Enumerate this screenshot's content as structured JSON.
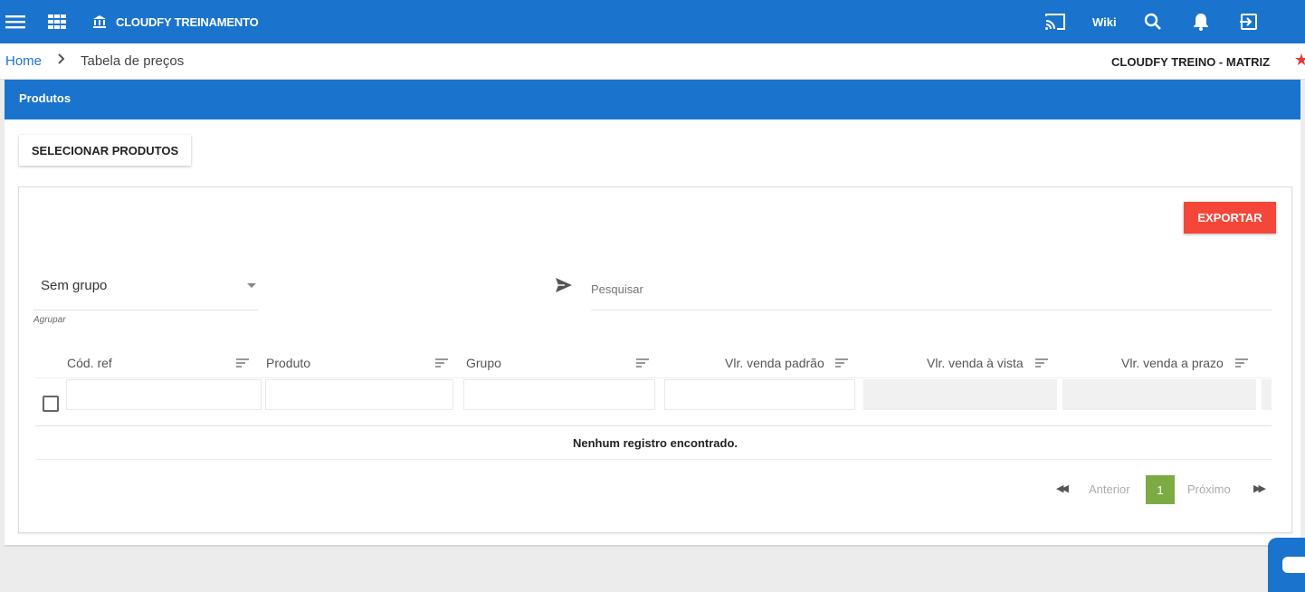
{
  "topbar": {
    "app_title": "CLOUDFY TREINAMENTO",
    "wiki_label": "Wiki",
    "icons": [
      "menu-icon",
      "grid-icon",
      "bank-icon",
      "cast-icon",
      "search-icon",
      "bell-icon",
      "logout-icon",
      "more-vert-icon"
    ],
    "color": "#1a73cc"
  },
  "breadcrumb": {
    "home": "Home",
    "separator": ">",
    "current": "Tabela de preços",
    "company": "CLOUDFY TREINO - MATRIZ"
  },
  "panel": {
    "title": "Produtos",
    "select_button": "SELECIONAR PRODUTOS",
    "export_button": "EXPORTAR",
    "export_color": "#f4473a",
    "group_select": {
      "value": "Sem grupo",
      "label": "Agrupar"
    },
    "search": {
      "placeholder": "Pesquisar"
    },
    "table": {
      "columns": [
        "Cód. ref",
        "Produto",
        "Grupo",
        "Vlr. venda padrão",
        "Vlr. venda à vista",
        "Vlr. venda a prazo"
      ],
      "empty_message": "Nenhum registro encontrado."
    },
    "pagination": {
      "previous": "Anterior",
      "current_page": "1",
      "next": "Próximo",
      "page_color": "#7cab44"
    }
  }
}
